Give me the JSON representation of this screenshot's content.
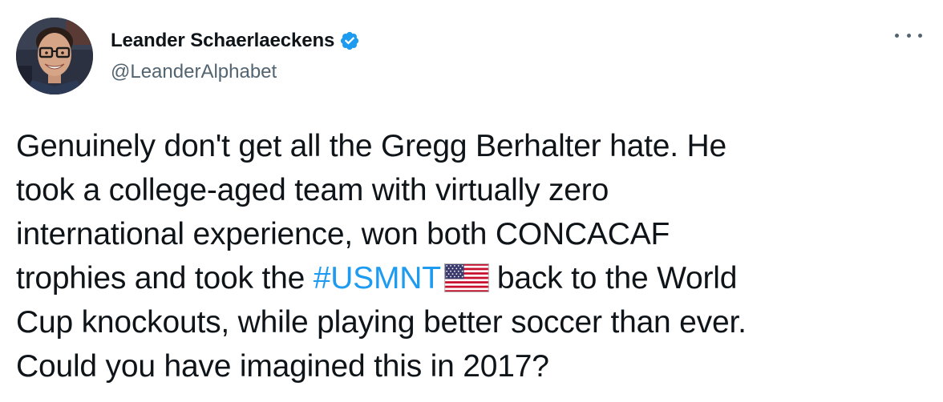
{
  "author": {
    "display_name": "Leander Schaerlaeckens",
    "handle": "@LeanderAlphabet",
    "verified": true,
    "avatar_icon": "avatar-photo-icon"
  },
  "menu": {
    "icon": "more-options-icon"
  },
  "tweet": {
    "lines": {
      "l1": "Genuinely don't get all the Gregg Berhalter hate. He",
      "l2": "took a college-aged team with virtually zero",
      "l3": "international experience, won both CONCACAF",
      "l4_pre": "trophies and took the ",
      "l4_hashtag": "#USMNT",
      "l4_post": "back to the World",
      "l5": "Cup knockouts, while playing better soccer than ever.",
      "l6": "Could you have imagined this in 2017?"
    },
    "hashtag_color": "#1d9bf0",
    "emoji": "us-flag-icon"
  },
  "colors": {
    "text": "#0f1419",
    "secondary": "#536471",
    "verified_badge": "#1d9bf0"
  }
}
